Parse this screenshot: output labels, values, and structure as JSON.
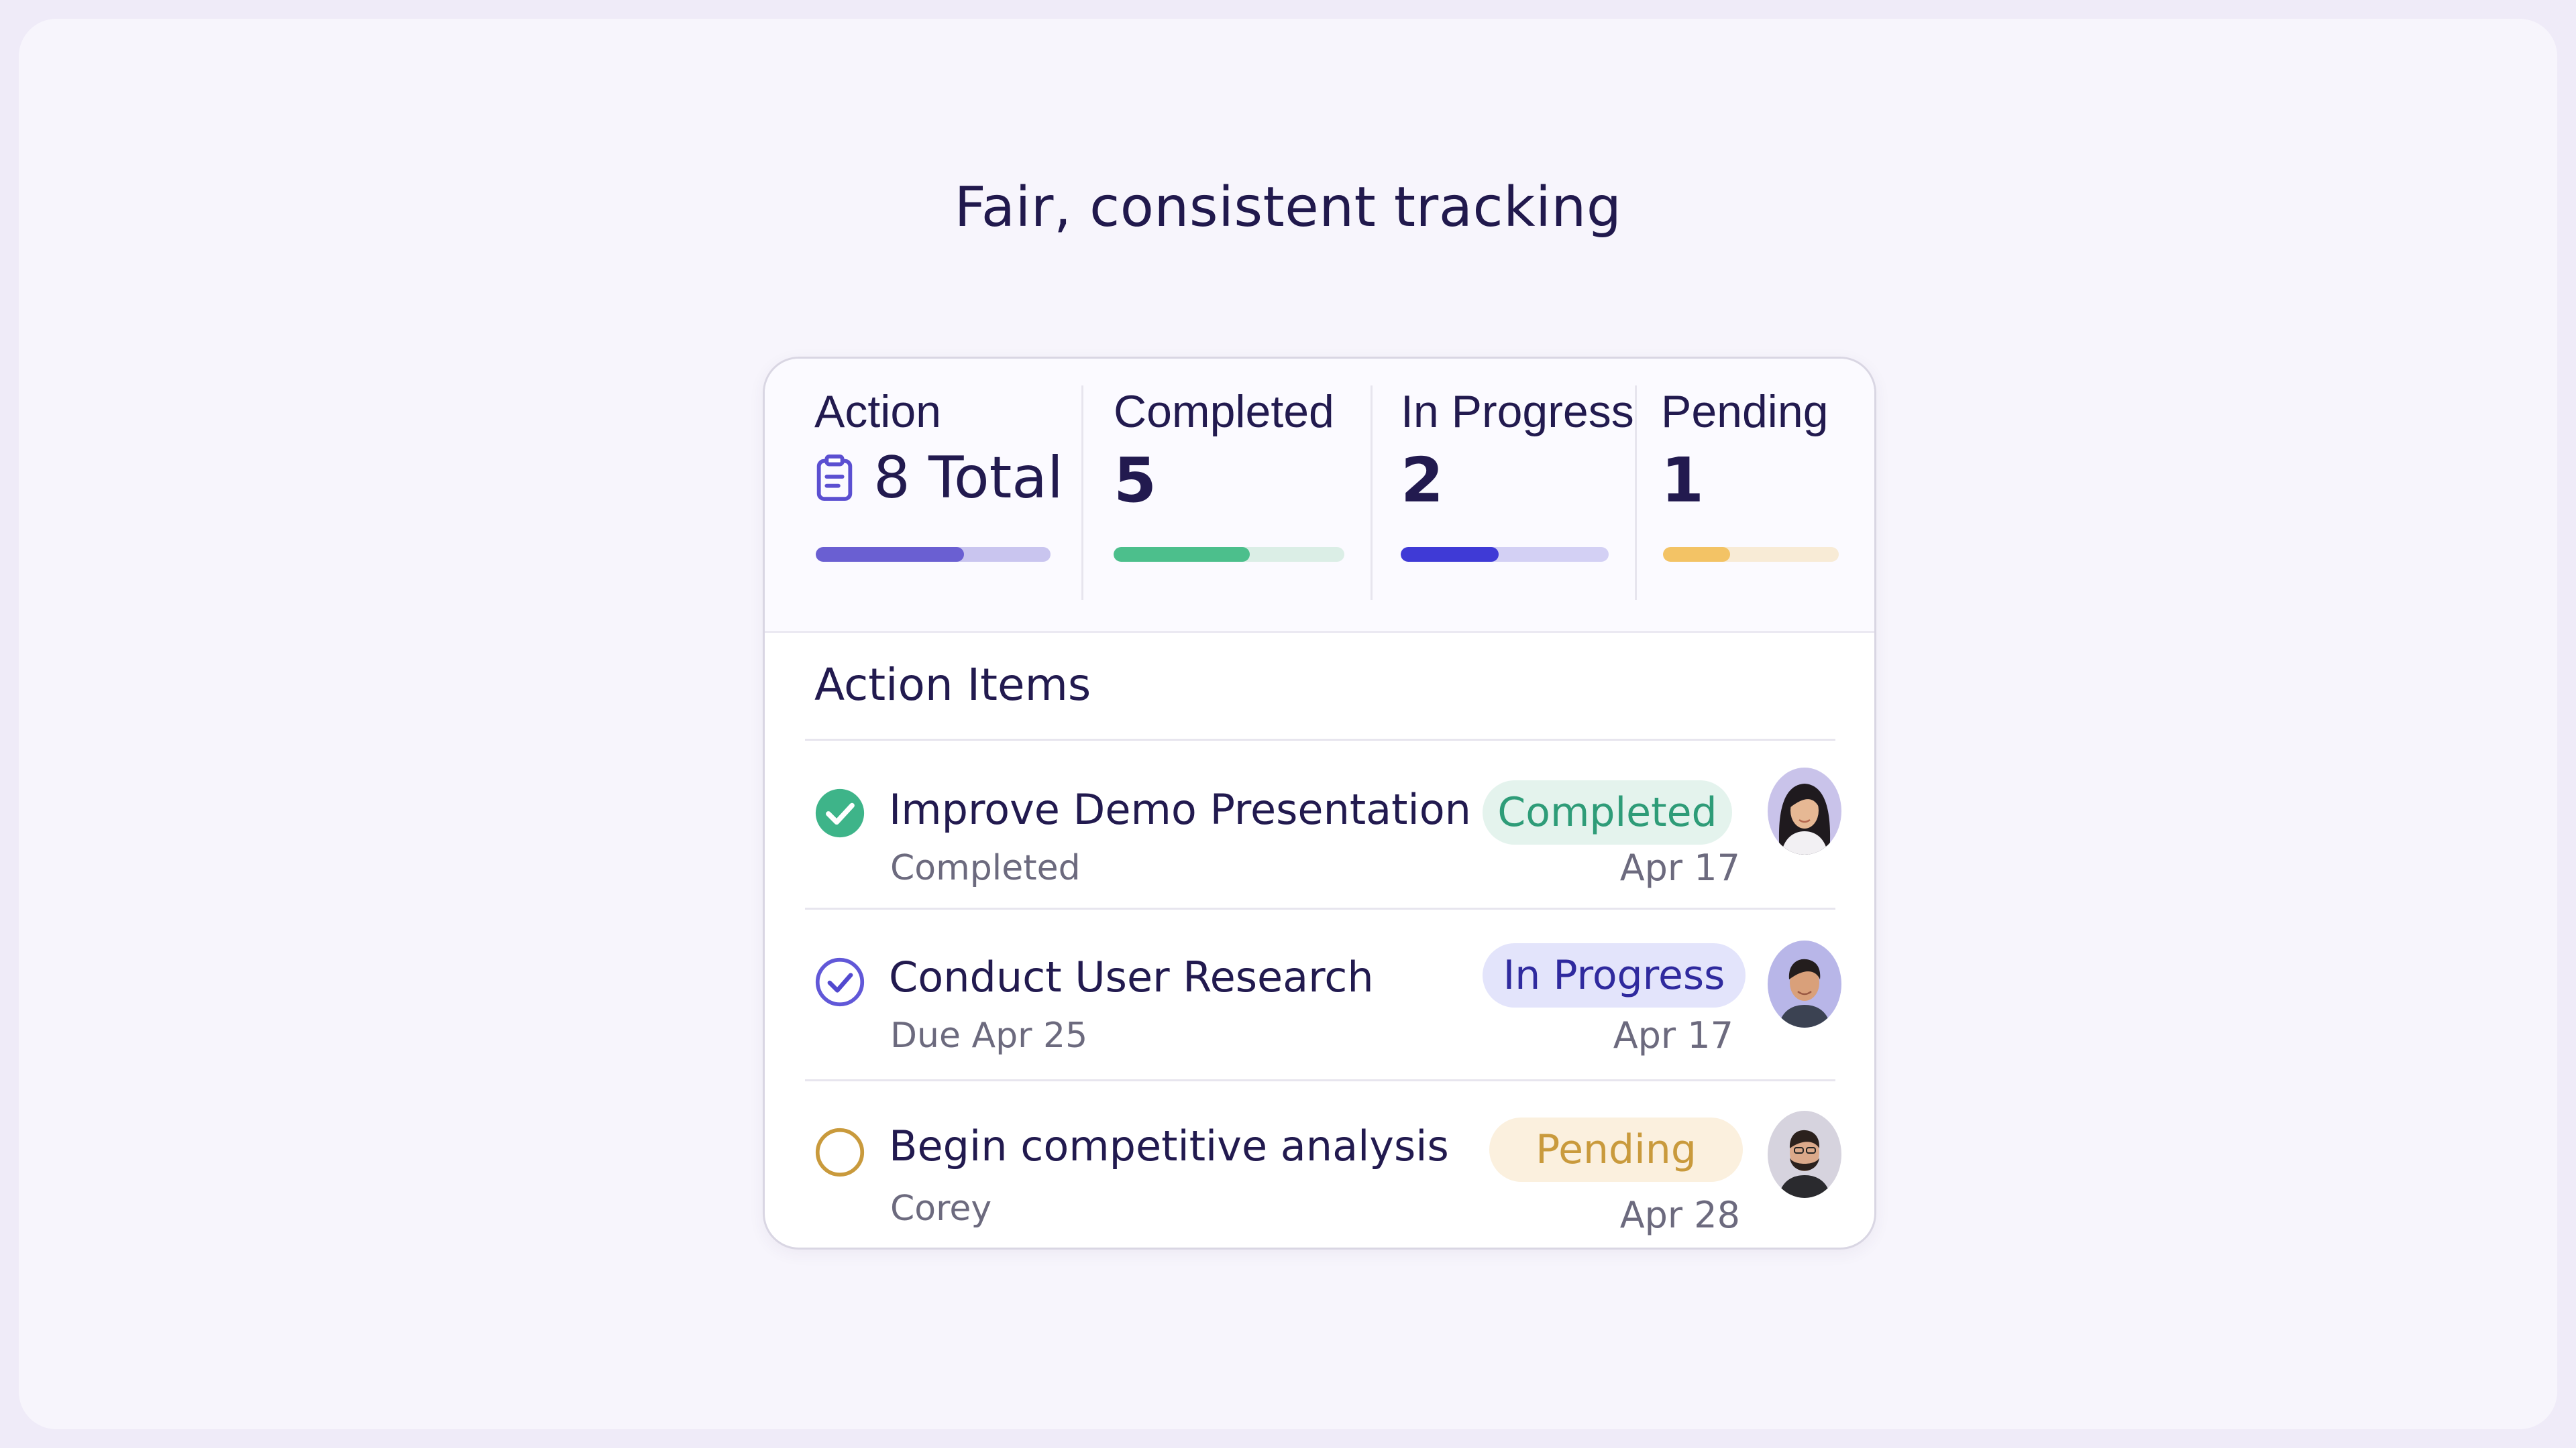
{
  "headline": "Fair, consistent tracking",
  "stats": [
    {
      "label": "Action",
      "value": "8 Total",
      "icon": "clipboard-icon",
      "progress": 0.63,
      "fill_color": "#6a5fd2",
      "track_color": "#c9c5ef"
    },
    {
      "label": "Completed",
      "value": "5",
      "progress": 0.59,
      "fill_color": "#4cbf8c",
      "track_color": "#dbeee6"
    },
    {
      "label": "In Progress",
      "value": "2",
      "progress": 0.47,
      "fill_color": "#3f3ad6",
      "track_color": "#d3d0f4"
    },
    {
      "label": "Pending",
      "value": "1",
      "progress": 0.38,
      "fill_color": "#f3c365",
      "track_color": "#f8ebd6"
    }
  ],
  "action_items": {
    "title": "Action Items",
    "items": [
      {
        "title": "Improve Demo Presentation",
        "subtitle": "Completed",
        "status": "Completed",
        "date": "Apr 17",
        "status_icon": "check-circle-filled-icon",
        "status_color": "#2e9c78",
        "status_bg": "#e4f3ed"
      },
      {
        "title": "Conduct User Research",
        "subtitle": "Due Apr 25",
        "status": "In Progress",
        "date": "Apr 17",
        "status_icon": "check-circle-outline-icon",
        "status_color": "#2f2a9e",
        "status_bg": "#e3e4fb"
      },
      {
        "title": "Begin competitive analysis",
        "subtitle": "Corey",
        "status": "Pending",
        "date": "Apr 28",
        "status_icon": "empty-circle-icon",
        "status_color": "#c99a3c",
        "status_bg": "#fbf0de"
      }
    ]
  }
}
